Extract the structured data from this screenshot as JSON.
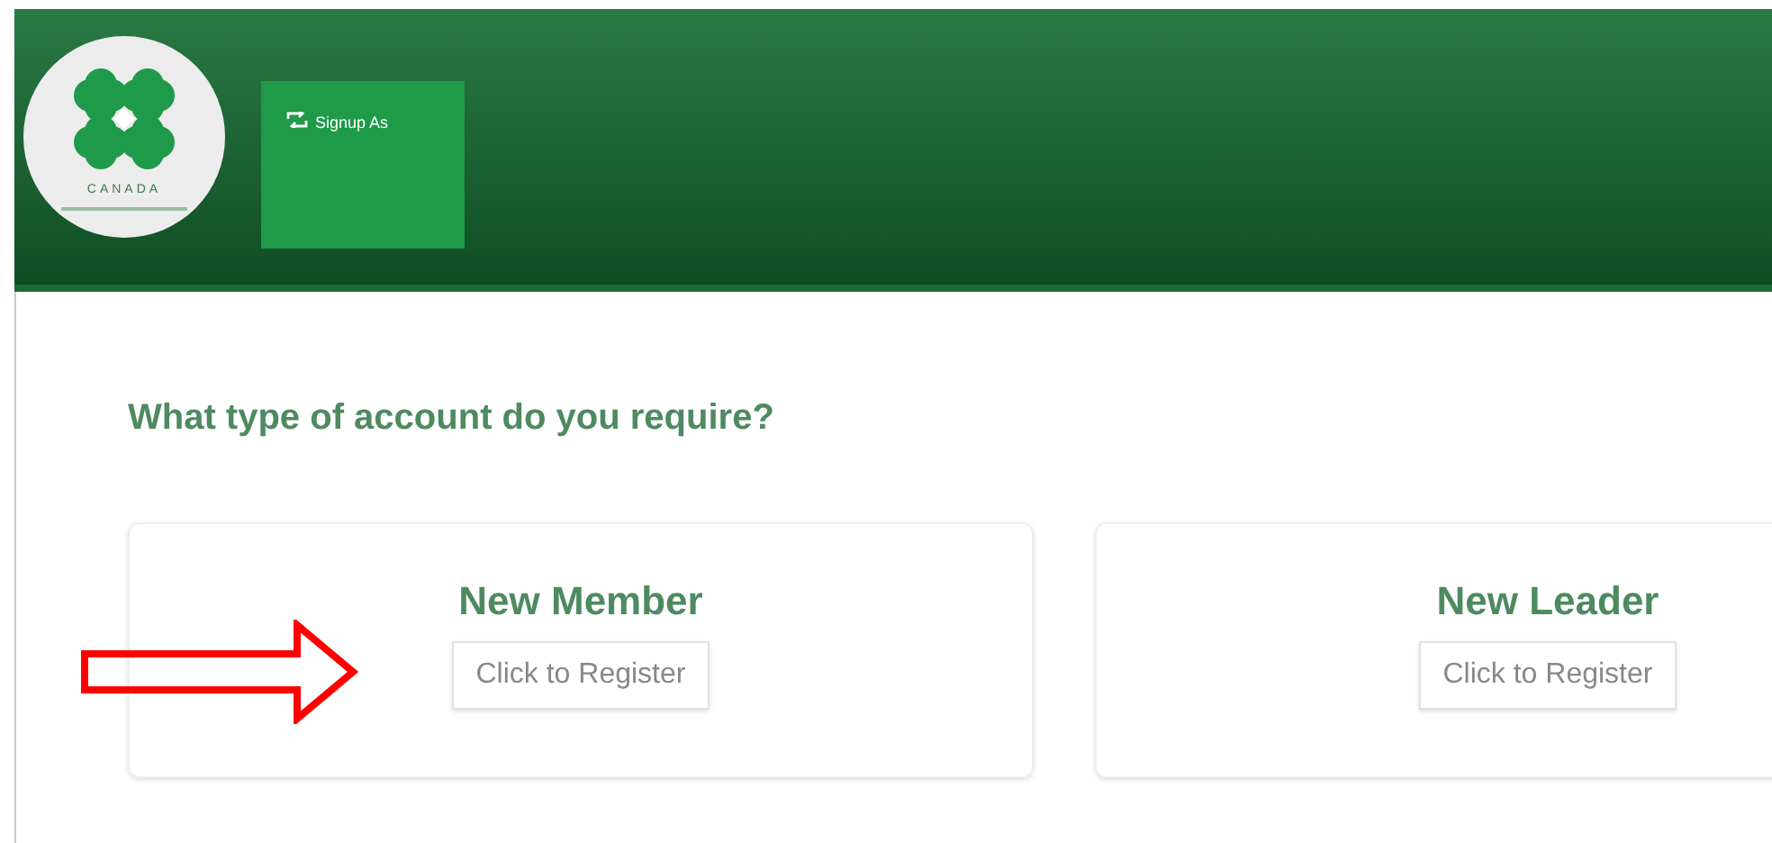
{
  "header": {
    "logo": {
      "text": "CANADA"
    },
    "signup_tab": {
      "label": "Signup As"
    }
  },
  "question": "What type of account do you require?",
  "options": [
    {
      "title": "New Member",
      "button": "Click to Register",
      "annotated": true
    },
    {
      "title": "New Leader",
      "button": "Click to Register",
      "annotated": false
    }
  ]
}
